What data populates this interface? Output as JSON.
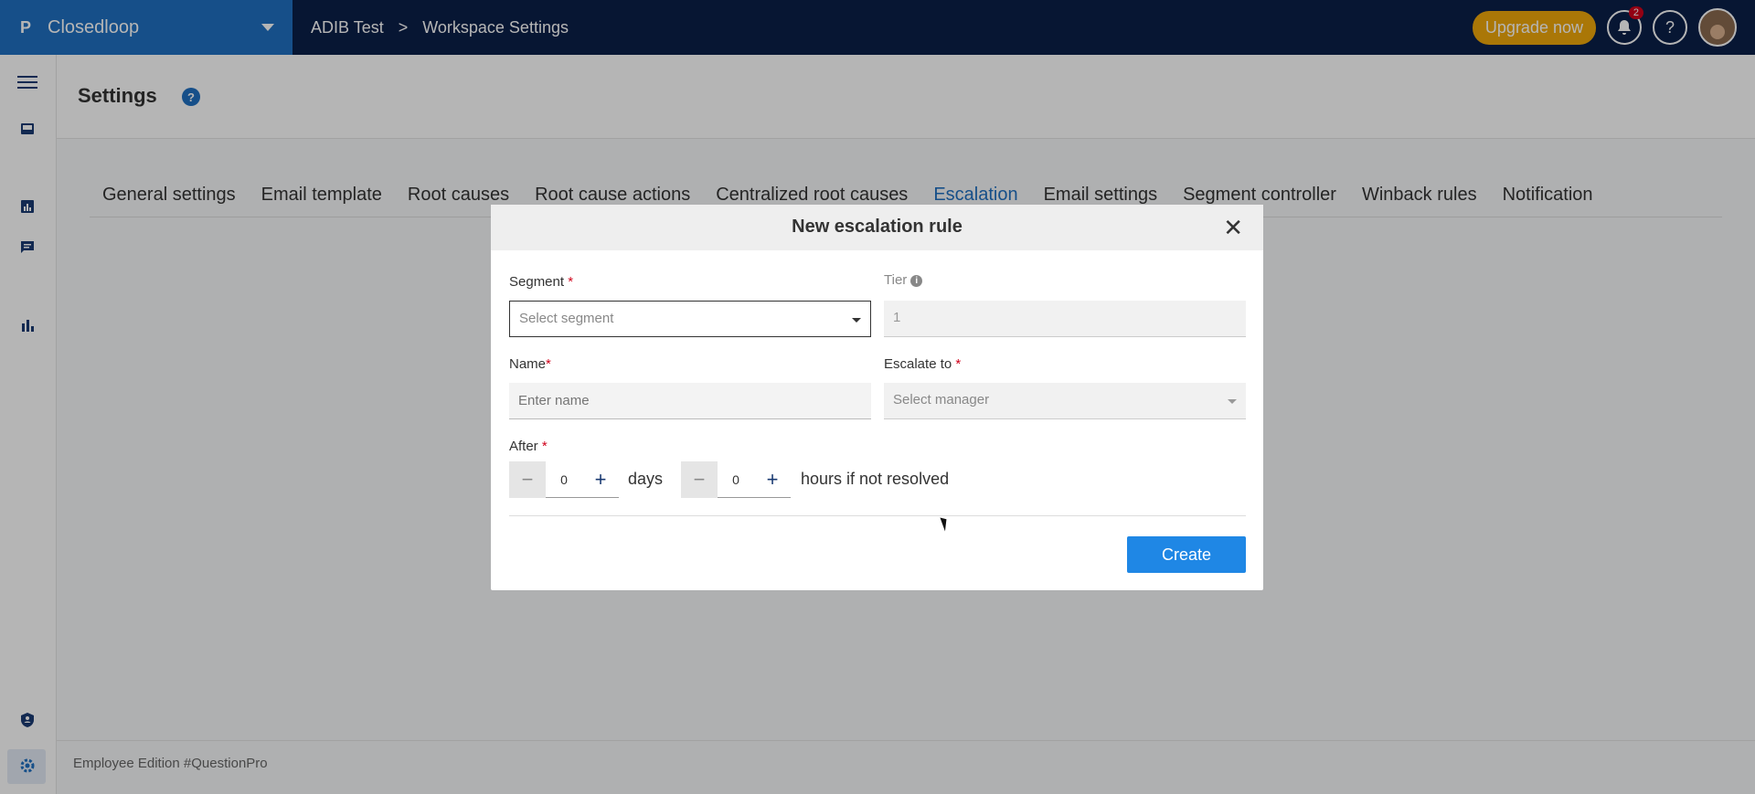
{
  "topbar": {
    "brand_logo": "P",
    "brand_name": "Closedloop",
    "breadcrumb": [
      "ADIB Test",
      "Workspace Settings"
    ],
    "breadcrumb_separator": ">",
    "upgrade_label": "Upgrade now",
    "notification_count": "2",
    "help_label": "?"
  },
  "page": {
    "title": "Settings",
    "help_icon": "?"
  },
  "tabs": [
    {
      "label": "General settings"
    },
    {
      "label": "Email template"
    },
    {
      "label": "Root causes"
    },
    {
      "label": "Root cause actions"
    },
    {
      "label": "Centralized root causes"
    },
    {
      "label": "Escalation",
      "active": true
    },
    {
      "label": "Email settings"
    },
    {
      "label": "Segment controller"
    },
    {
      "label": "Winback rules"
    },
    {
      "label": "Notification"
    }
  ],
  "footer": {
    "text": "Employee Edition #QuestionPro"
  },
  "modal": {
    "title": "New escalation rule",
    "close": "✕",
    "segment_label": "Segment",
    "segment_placeholder": "Select segment",
    "tier_label": "Tier",
    "tier_value": "1",
    "name_label": "Name",
    "name_placeholder": "Enter name",
    "escalate_label": "Escalate to",
    "escalate_placeholder": "Select manager",
    "after_label": "After",
    "required_mark": "*",
    "days_value": "0",
    "days_unit": "days",
    "hours_value": "0",
    "hours_unit": "hours if not resolved",
    "minus": "−",
    "plus": "+",
    "create_label": "Create"
  },
  "colors": {
    "topbar": "#0b1f48",
    "brand": "#1f70c1",
    "accent": "#1f87e5",
    "upgrade": "#f0a80a",
    "required": "#d0021b"
  }
}
